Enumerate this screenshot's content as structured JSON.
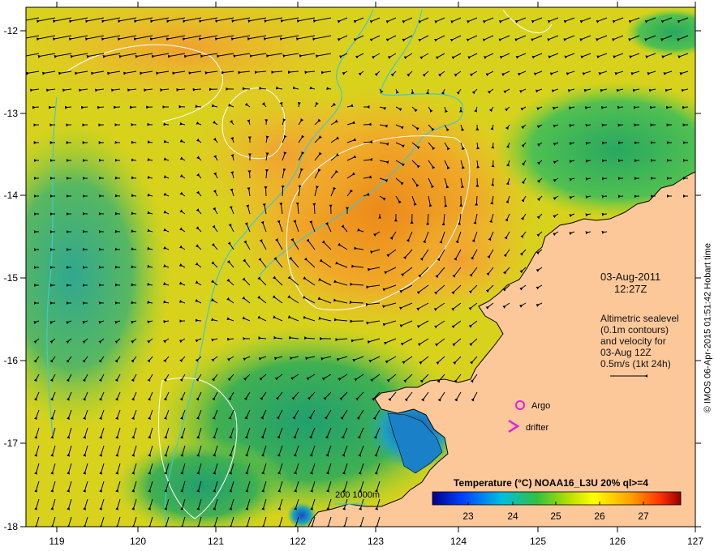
{
  "map": {
    "date": "03-Aug-2011",
    "time": "12:27Z",
    "altimetry_lines": [
      "Altimetric sealevel",
      "(0.1m contours)",
      "and velocity for",
      "03-Aug 12Z",
      "0.5m/s (1kt 24h)"
    ],
    "legend": {
      "argo": "Argo",
      "drifter": "drifter",
      "argo_color": "#e020e0",
      "drifter_color": "#e020e0"
    },
    "bathymetry_label": "200  1000m",
    "bathymetry_color": "#40c8d0",
    "colorbar": {
      "title": "Temperature (°C) NOAA16_L3U 20% ql>=4",
      "ticks": [
        "23",
        "24",
        "25",
        "26",
        "27"
      ]
    },
    "lon_labels": [
      "119",
      "120",
      "121",
      "122",
      "123",
      "124",
      "125",
      "126",
      "127"
    ],
    "lat_labels": [
      "-12",
      "-13",
      "-14",
      "-15",
      "-16",
      "-17",
      "-18"
    ],
    "credit": "© IMOS 06-Apr-2015 01:51:42 Hobart time",
    "colors": {
      "land": "#fcc89a",
      "warm": "#f0a020",
      "mid": "#dccc14",
      "cool": "#30b048",
      "cold": "#1050c0"
    }
  }
}
